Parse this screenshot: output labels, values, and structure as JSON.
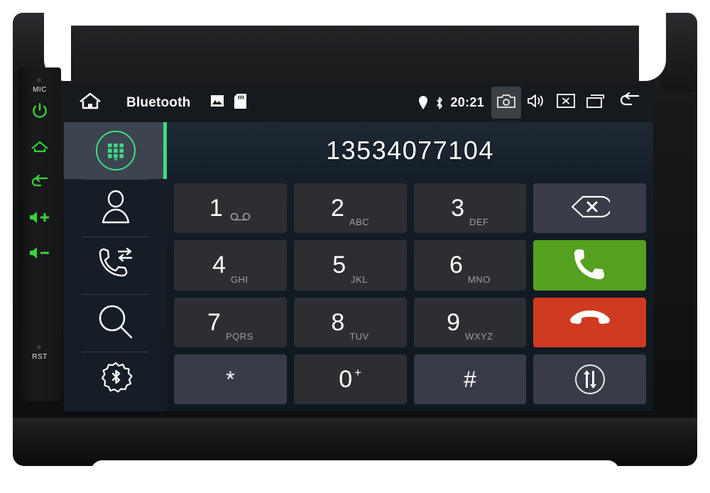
{
  "device": {
    "hardware_buttons": [
      {
        "name": "mic",
        "label": "MIC",
        "type": "hole"
      },
      {
        "name": "power",
        "label": "",
        "type": "icon",
        "icon": "power-icon"
      },
      {
        "name": "home",
        "label": "",
        "type": "icon",
        "icon": "home-icon"
      },
      {
        "name": "back",
        "label": "",
        "type": "icon",
        "icon": "back-arrow-icon"
      },
      {
        "name": "volume-up",
        "label": "",
        "type": "icon",
        "icon": "volume-up-icon"
      },
      {
        "name": "volume-down",
        "label": "",
        "type": "icon",
        "icon": "volume-down-icon"
      },
      {
        "name": "reset",
        "label": "RST",
        "type": "hole"
      }
    ],
    "accent_color": "#35d43a"
  },
  "statusbar": {
    "home_icon": "home-icon",
    "title": "Bluetooth",
    "photo_icon": "picture-icon",
    "sdcard_icon": "sd-card-icon",
    "location_icon": "location-pin-icon",
    "bluetooth_icon": "bluetooth-icon",
    "clock": "20:21",
    "screenshot_icon": "camera-icon",
    "volume_icon": "speaker-icon",
    "close_icon": "close-box-icon",
    "recents_icon": "recents-icon",
    "back_icon": "back-arrow-icon"
  },
  "sidebar": {
    "items": [
      {
        "name": "dialpad",
        "icon": "dialpad-icon",
        "active": true
      },
      {
        "name": "contacts",
        "icon": "contact-person-icon",
        "active": false
      },
      {
        "name": "call-history",
        "icon": "call-transfer-icon",
        "active": false
      },
      {
        "name": "search",
        "icon": "magnifier-icon",
        "active": false
      },
      {
        "name": "bluetooth-settings",
        "icon": "bluetooth-gear-icon",
        "active": false
      }
    ],
    "accent_color": "#3ddc84"
  },
  "dialer": {
    "number": "13534077104",
    "keys": [
      {
        "digit": "1",
        "letters": "",
        "voicemail": true,
        "sup": "",
        "style": "normal"
      },
      {
        "digit": "2",
        "letters": "ABC",
        "voicemail": false,
        "sup": "",
        "style": "normal"
      },
      {
        "digit": "3",
        "letters": "DEF",
        "voicemail": false,
        "sup": "",
        "style": "normal"
      },
      {
        "digit": "4",
        "letters": "GHI",
        "voicemail": false,
        "sup": "",
        "style": "normal"
      },
      {
        "digit": "5",
        "letters": "JKL",
        "voicemail": false,
        "sup": "",
        "style": "normal"
      },
      {
        "digit": "6",
        "letters": "MNO",
        "voicemail": false,
        "sup": "",
        "style": "normal"
      },
      {
        "digit": "7",
        "letters": "PQRS",
        "voicemail": false,
        "sup": "",
        "style": "normal"
      },
      {
        "digit": "8",
        "letters": "TUV",
        "voicemail": false,
        "sup": "",
        "style": "normal"
      },
      {
        "digit": "9",
        "letters": "WXYZ",
        "voicemail": false,
        "sup": "",
        "style": "normal"
      },
      {
        "digit": "*",
        "letters": "",
        "voicemail": false,
        "sup": "",
        "style": "alt"
      },
      {
        "digit": "0",
        "letters": "",
        "voicemail": false,
        "sup": "+",
        "style": "normal"
      },
      {
        "digit": "#",
        "letters": "",
        "voicemail": false,
        "sup": "",
        "style": "alt"
      }
    ],
    "actions": [
      {
        "name": "backspace",
        "icon": "backspace-icon",
        "color": "#393c48"
      },
      {
        "name": "call",
        "icon": "call-icon",
        "color": "#55a11f"
      },
      {
        "name": "hangup",
        "icon": "hangup-icon",
        "color": "#cf3a21"
      },
      {
        "name": "audio-transfer",
        "icon": "audio-swap-icon",
        "color": "#393c48"
      }
    ]
  }
}
